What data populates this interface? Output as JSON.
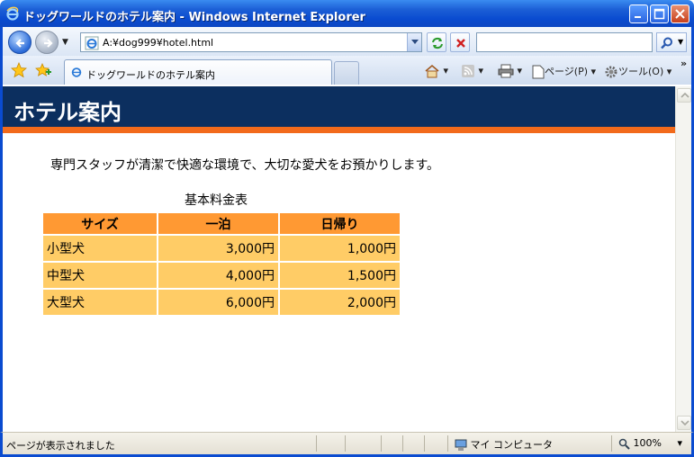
{
  "window": {
    "title": "ドッグワールドのホテル案内 - Windows Internet Explorer"
  },
  "address_bar": {
    "url": "A:¥dog999¥hotel.html"
  },
  "search": {
    "placeholder": ""
  },
  "tabs": [
    {
      "label": "ドッグワールドのホテル案内"
    }
  ],
  "command_bar": {
    "page_label": "ページ(P)",
    "tools_label": "ツール(O)"
  },
  "page": {
    "heading": "ホテル案内",
    "intro": "専門スタッフが清潔で快適な環境で、大切な愛犬をお預かりします。",
    "table_caption": "基本料金表",
    "table": {
      "headers": [
        "サイズ",
        "一泊",
        "日帰り"
      ],
      "rows": [
        {
          "size": "小型犬",
          "overnight": "3,000円",
          "daytrip": "1,000円"
        },
        {
          "size": "中型犬",
          "overnight": "4,000円",
          "daytrip": "1,500円"
        },
        {
          "size": "大型犬",
          "overnight": "6,000円",
          "daytrip": "2,000円"
        }
      ]
    }
  },
  "statusbar": {
    "status": "ページが表示されました",
    "zone": "マイ コンピュータ",
    "zoom": "100%"
  },
  "colors": {
    "header_bg": "#0c2f5f",
    "header_stripe": "#f26a1b",
    "table_header_bg": "#ff9933",
    "table_cell_bg": "#ffcc66"
  }
}
